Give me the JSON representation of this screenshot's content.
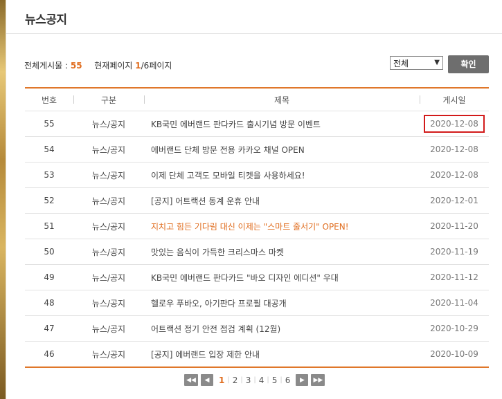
{
  "page": {
    "title": "뉴스공지"
  },
  "info": {
    "total_label": "전체게시물 :",
    "total_count": "55",
    "page_label": "현재페이지",
    "current_page": "1",
    "page_suffix": "/6페이지"
  },
  "filter": {
    "selected": "전체",
    "confirm_label": "확인"
  },
  "table": {
    "headers": [
      "번호",
      "구분",
      "제목",
      "게시일"
    ],
    "rows": [
      {
        "no": "55",
        "category": "뉴스/공지",
        "title": "KB국민 에버랜드 판다카드 출시기념 방문 이벤트",
        "date": "2020-12-08"
      },
      {
        "no": "54",
        "category": "뉴스/공지",
        "title": "에버랜드 단체 방문 전용 카카오 채널 OPEN",
        "date": "2020-12-08"
      },
      {
        "no": "53",
        "category": "뉴스/공지",
        "title": "이제 단체 고객도 모바일 티켓을 사용하세요!",
        "date": "2020-12-08"
      },
      {
        "no": "52",
        "category": "뉴스/공지",
        "title": "[공지] 어트랙션 동계 운휴 안내",
        "date": "2020-12-01"
      },
      {
        "no": "51",
        "category": "뉴스/공지",
        "title": "지치고 힘든 기다림 대신 이제는 \"스마트 줄서기\" OPEN!",
        "date": "2020-11-20"
      },
      {
        "no": "50",
        "category": "뉴스/공지",
        "title": "맛있는 음식이 가득한 크리스마스 마켓",
        "date": "2020-11-19"
      },
      {
        "no": "49",
        "category": "뉴스/공지",
        "title": "KB국민 에버랜드 판다카드 \"바오 디자인 에디션\" 우대",
        "date": "2020-11-12"
      },
      {
        "no": "48",
        "category": "뉴스/공지",
        "title": "헬로우 푸바오, 아기판다 프로필 대공개",
        "date": "2020-11-04"
      },
      {
        "no": "47",
        "category": "뉴스/공지",
        "title": "어트랙션 정기 안전 점검 계획 (12월)",
        "date": "2020-10-29"
      },
      {
        "no": "46",
        "category": "뉴스/공지",
        "title": "[공지] 에버랜드 입장 제한 안내",
        "date": "2020-10-09"
      }
    ]
  },
  "pagination": {
    "pages": [
      "1",
      "2",
      "3",
      "4",
      "5",
      "6"
    ],
    "current": "1",
    "first_icon": "double-left-arrow",
    "prev_icon": "left-arrow",
    "next_icon": "right-arrow",
    "last_icon": "double-right-arrow"
  },
  "colors": {
    "accent": "#e06d1f",
    "highlight_box": "#d21a1a",
    "button_gray": "#6e6e6e"
  }
}
